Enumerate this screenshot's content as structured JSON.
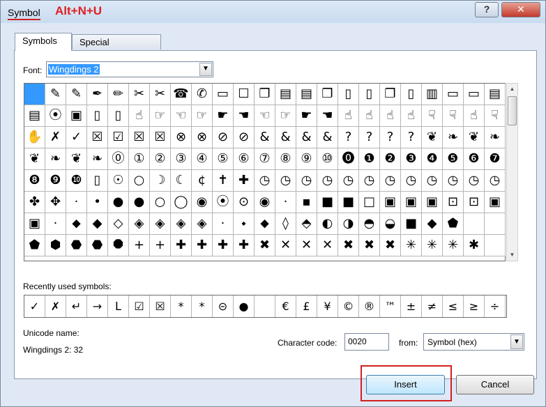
{
  "dialog": {
    "title": "Symbol",
    "shortcut": "Alt+N+U",
    "help_glyph": "?",
    "close_glyph": "✕"
  },
  "tabs": [
    "Symbols",
    "Special Characters"
  ],
  "font": {
    "label": "Font:",
    "value": "Wingdings 2"
  },
  "grid": {
    "selected_index": 0,
    "rows": [
      [
        "",
        "✎",
        "✎",
        "✒",
        "✏",
        "✂",
        "✂",
        "☎",
        "✆",
        "▭",
        "☐",
        "❐",
        "▤",
        "▤",
        "❐",
        "▯",
        "▯",
        "❐",
        "▯",
        "▥",
        "▭",
        "▭",
        "▤"
      ],
      [
        "▤",
        "⦿",
        "▣",
        "▯",
        "▯",
        "☝",
        "☞",
        "☜",
        "☞",
        "☛",
        "☚",
        "☜",
        "☞",
        "☛",
        "☚",
        "☝",
        "☝",
        "☝",
        "☝",
        "☟",
        "☟",
        "☝",
        "☟"
      ],
      [
        "✋",
        "✗",
        "✓",
        "☒",
        "☑",
        "☒",
        "☒",
        "⊗",
        "⊗",
        "⊘",
        "⊘",
        "&",
        "&",
        "&",
        "&",
        "?",
        "?",
        "?",
        "?",
        "❦",
        "❧",
        "❦",
        "❧"
      ],
      [
        "❦",
        "❧",
        "❦",
        "❧",
        "⓪",
        "①",
        "②",
        "③",
        "④",
        "⑤",
        "⑥",
        "⑦",
        "⑧",
        "⑨",
        "⑩",
        "⓿",
        "❶",
        "❷",
        "❸",
        "❹",
        "❺",
        "❻",
        "❼"
      ],
      [
        "❽",
        "❾",
        "❿",
        "▯",
        "☉",
        "○",
        "☽",
        "☾",
        "¢",
        "✝",
        "✚",
        "◷",
        "◷",
        "◷",
        "◷",
        "◷",
        "◷",
        "◷",
        "◷",
        "◷",
        "◷",
        "◷",
        "◷"
      ],
      [
        "✤",
        "✥",
        "·",
        "•",
        "●",
        "●",
        "○",
        "◯",
        "◉",
        "⦿",
        "⊙",
        "◉",
        "·",
        "▪",
        "■",
        "■",
        "□",
        "▣",
        "▣",
        "▣",
        "⊡",
        "⊡",
        "▣"
      ],
      [
        "▣",
        "·",
        "⬥",
        "◆",
        "◇",
        "◈",
        "◈",
        "◈",
        "◈",
        "·",
        "⬩",
        "⬥",
        "◊",
        "⬘",
        "◐",
        "◑",
        "◓",
        "◒",
        "■",
        "◆",
        "⬟",
        "",
        ""
      ],
      [
        "⬟",
        "⬢",
        "⬣",
        "⬣",
        "⯃",
        "+",
        "+",
        "✚",
        "✚",
        "✚",
        "✚",
        "✖",
        "✕",
        "✕",
        "✕",
        "✖",
        "✖",
        "✖",
        "✳",
        "✳",
        "✳",
        "✱",
        ""
      ]
    ]
  },
  "scrollbar": {
    "up_glyph": "▲",
    "down_glyph": "▼"
  },
  "recent": {
    "label": "Recently used symbols:",
    "items": [
      "✓",
      "✗",
      "↵",
      "→",
      "ᒪ",
      "☑",
      "☒",
      "*",
      "*",
      "⊝",
      "●",
      "",
      "€",
      "£",
      "¥",
      "©",
      "®",
      "™",
      "±",
      "≠",
      "≤",
      "≥",
      "÷"
    ]
  },
  "unicode": {
    "label": "Unicode name:",
    "value": "Wingdings 2: 32"
  },
  "character_code": {
    "label": "Character code:",
    "value": "0020"
  },
  "from": {
    "label": "from:",
    "value": "Symbol (hex)"
  },
  "buttons": {
    "insert": "Insert",
    "cancel": "Cancel"
  },
  "colors": {
    "accent": "#3399ff",
    "highlight": "#d12020"
  }
}
